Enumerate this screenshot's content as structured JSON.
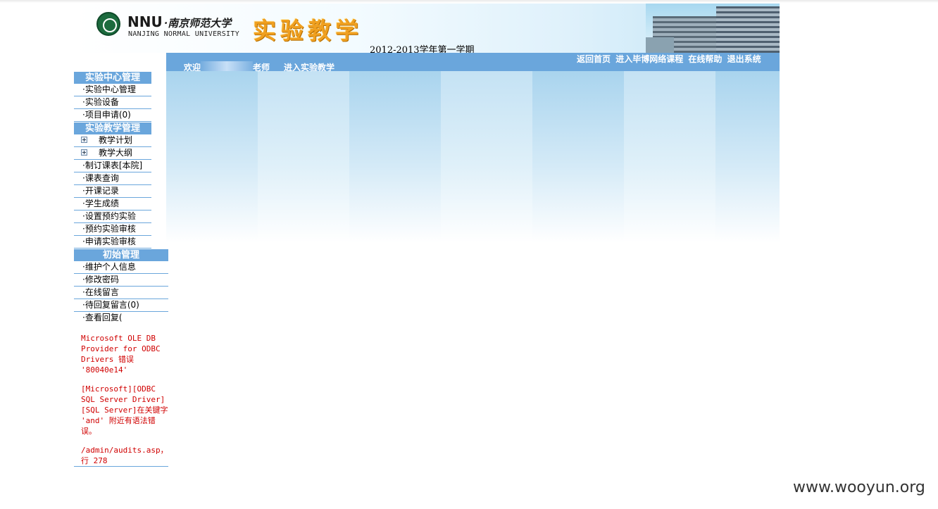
{
  "header": {
    "logo_short": "NNU",
    "logo_cn": "·南京师范大学",
    "logo_en": "NANJING NORMAL UNIVERSITY",
    "site_title": "实验教学",
    "semester": "2012-2013学年第一学期"
  },
  "bar": {
    "welcome_prefix": "欢迎",
    "welcome_suffix": "老师",
    "enter_link": "进入实验教学",
    "links": [
      "返回首页",
      "进入毕博网络课程",
      "在线帮助",
      "退出系统"
    ]
  },
  "sidebar": {
    "sections": [
      {
        "title": "实验中心管理"
      },
      {
        "title": "实验教学管理"
      },
      {
        "title": "初始管理"
      }
    ],
    "center_items": [
      "·实验中心管理",
      "·实验设备",
      "·项目申请(0)"
    ],
    "teaching_expand": [
      "教学计划",
      "教学大纲"
    ],
    "teaching_items": [
      "·制订课表[本院]",
      "·课表查询",
      "·开课记录",
      "·学生成绩",
      "·设置预约实验",
      "·预约实验审核",
      "·申请实验审核"
    ],
    "init_items": [
      "·维护个人信息",
      "·修改密码",
      "·在线留言",
      "·待回复留言(0)",
      "·查看回复("
    ]
  },
  "error": {
    "line1": "Microsoft OLE DB Provider for ODBC Drivers 错误 '80040e14'",
    "line2": "[Microsoft][ODBC SQL Server Driver][SQL Server]在关键字 'and' 附近有语法错误。",
    "line3": "/admin/audits.asp，行 278"
  },
  "watermark": "www.wooyun.org",
  "colors": {
    "bar": "#6aa6dc",
    "error": "#d00000",
    "title": "#f0a020"
  }
}
